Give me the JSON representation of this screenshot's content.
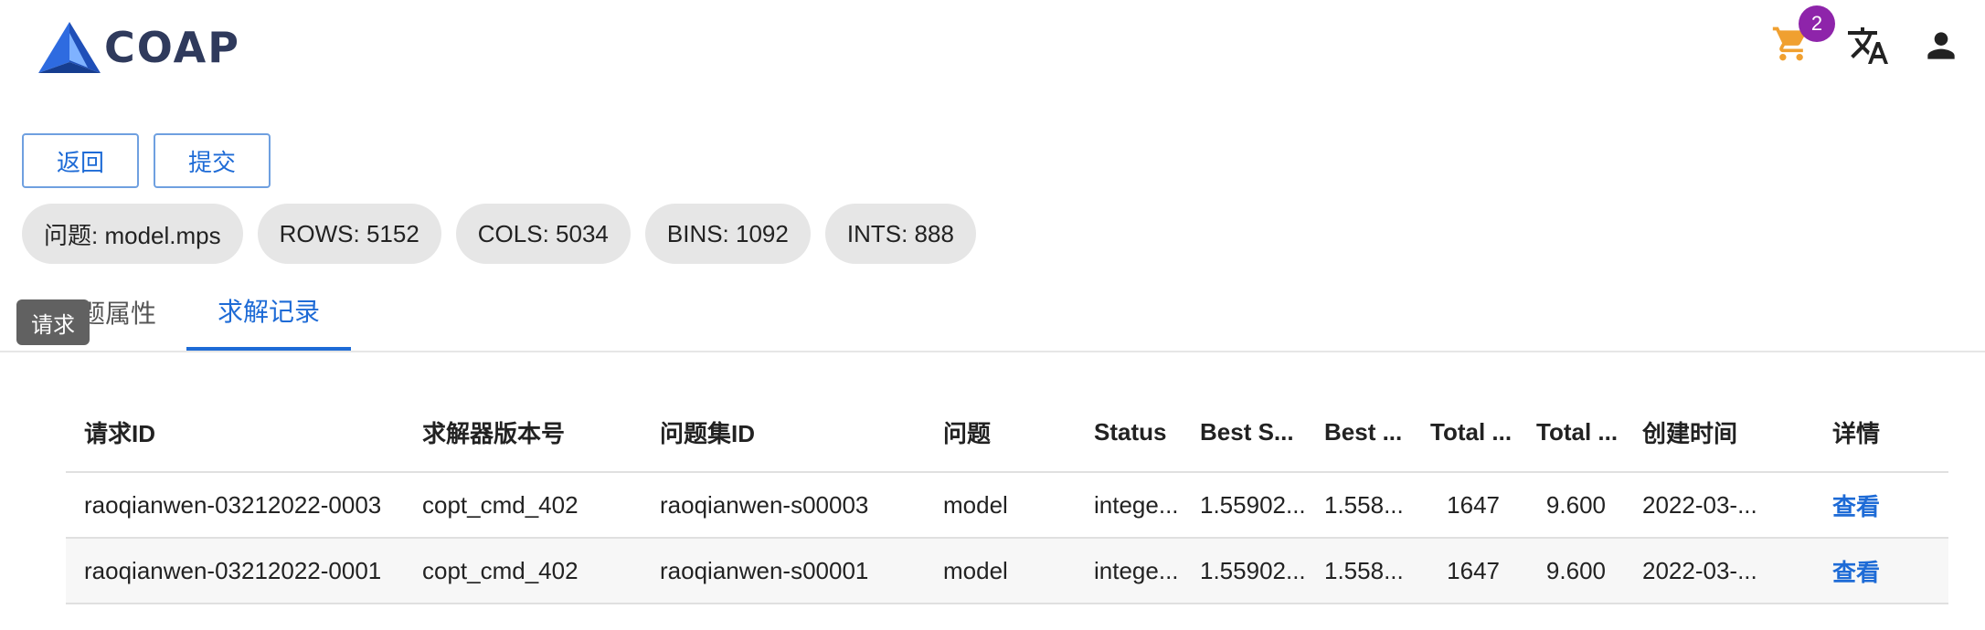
{
  "header": {
    "logo_text": "COAP",
    "cart_badge": "2",
    "icons": [
      "cart-icon",
      "translate-icon",
      "account-icon"
    ]
  },
  "actions": {
    "back_label": "返回",
    "submit_label": "提交"
  },
  "chips": [
    "问题: model.mps",
    "ROWS: 5152",
    "COLS: 5034",
    "BINS: 1092",
    "INTS: 888"
  ],
  "tabs": {
    "props_label": "问题属性",
    "records_label": "求解记录"
  },
  "tooltip": "请求",
  "table": {
    "headers": [
      "请求ID",
      "求解器版本号",
      "问题集ID",
      "问题",
      "Status",
      "Best S...",
      "Best ...",
      "Total ...",
      "Total ...",
      "创建时间",
      "详情"
    ],
    "rows": [
      [
        "raoqianwen-03212022-0003",
        "copt_cmd_402",
        "raoqianwen-s00003",
        "model",
        "intege...",
        "1.55902...",
        "1.558...",
        "1647",
        "9.600",
        "2022-03-...",
        "查看"
      ],
      [
        "raoqianwen-03212022-0001",
        "copt_cmd_402",
        "raoqianwen-s00001",
        "model",
        "intege...",
        "1.55902...",
        "1.558...",
        "1647",
        "9.600",
        "2022-03-...",
        "查看"
      ]
    ]
  },
  "colors": {
    "accent": "#1e6bd6",
    "badge": "#8e24aa",
    "cart": "#f0a030",
    "logo": "#2f3a5c"
  }
}
